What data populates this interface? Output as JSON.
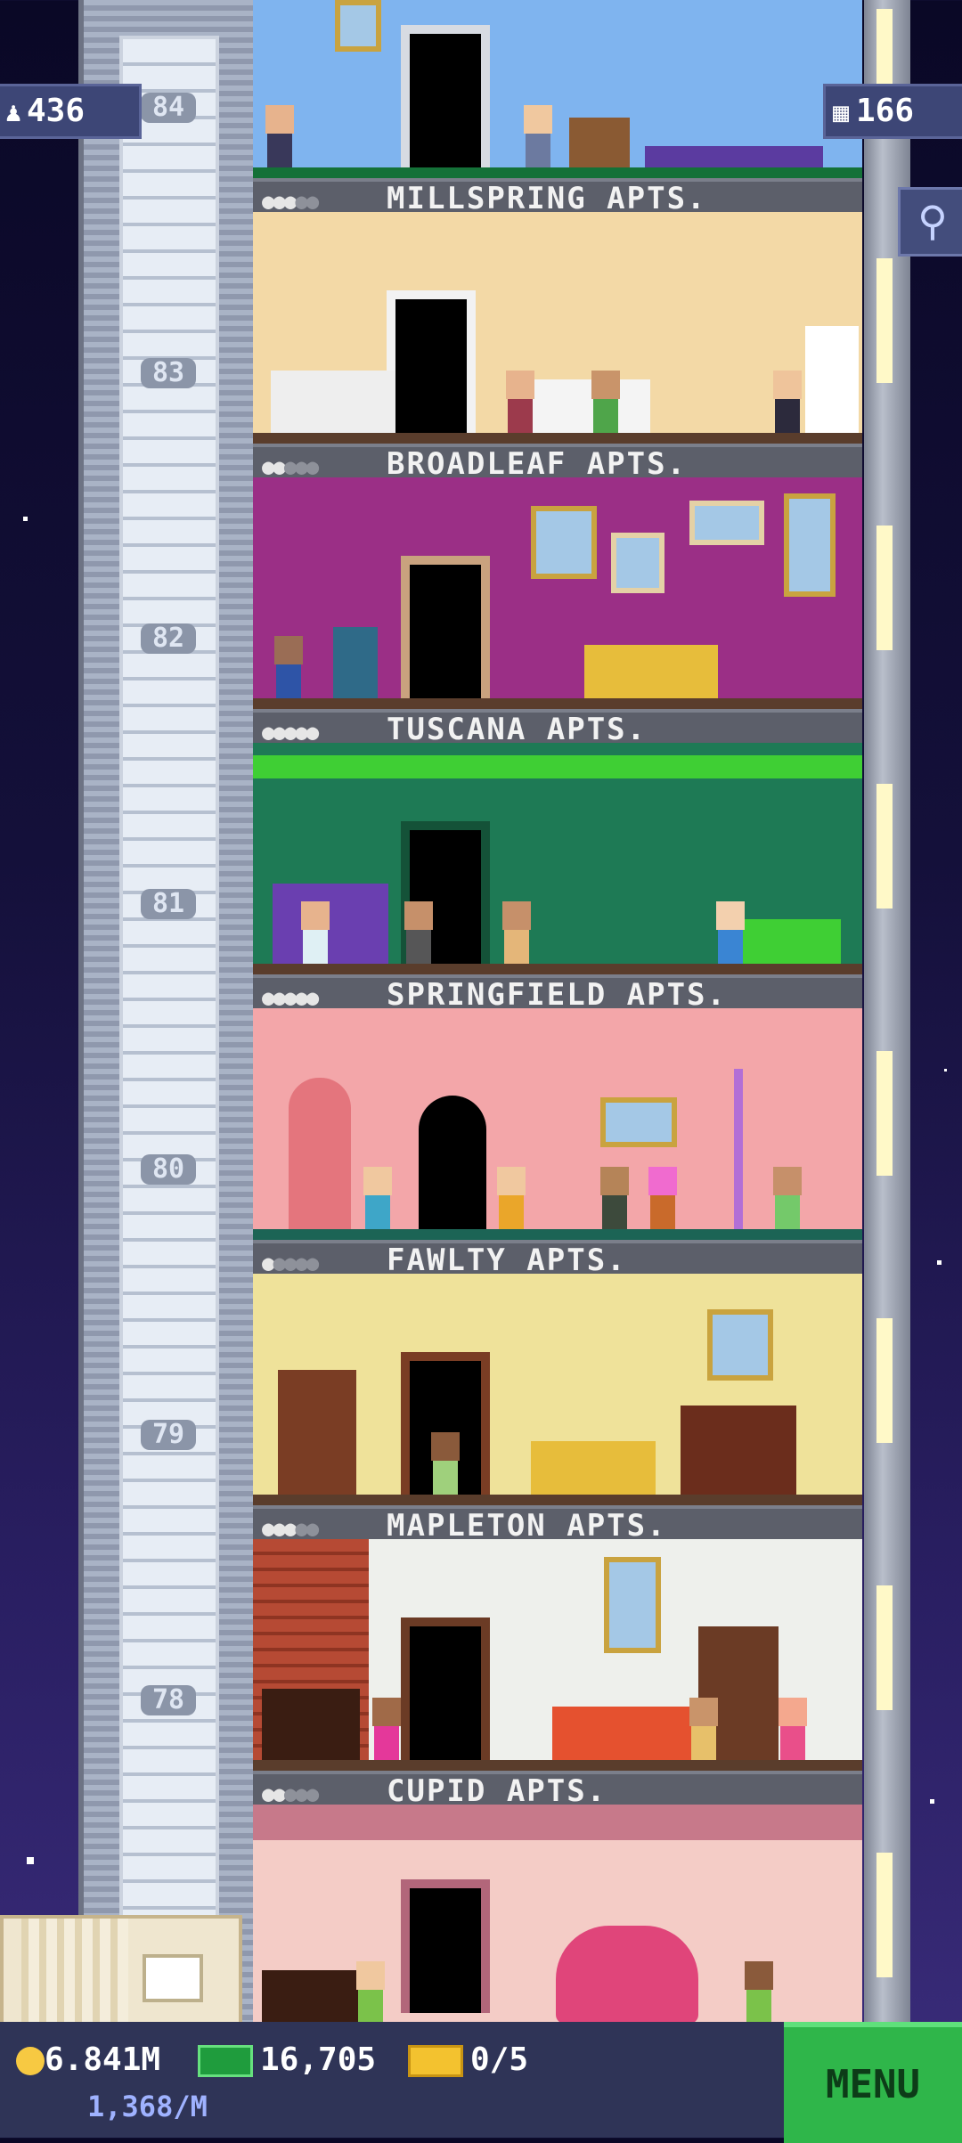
{
  "hud": {
    "population": "436",
    "floor_count": "166",
    "coins": "6.841M",
    "coin_rate": "1,368/M",
    "bux": "16,705",
    "tickets": "0/5",
    "menu_label": "MENU"
  },
  "icons": {
    "population": "person-icon",
    "floors": "building-icon",
    "search": "magnifier-icon",
    "coin": "coin-icon",
    "bux": "cash-icon",
    "ticket": "vip-ticket-icon",
    "crate": "delivery-box-icon"
  },
  "floors": [
    {
      "number": "84",
      "name": "MILLSPRING APTS.",
      "occupied": 3,
      "capacity": 5,
      "wall": "#7fb4ef"
    },
    {
      "number": "83",
      "name": "BROADLEAF APTS.",
      "occupied": 2,
      "capacity": 5,
      "wall": "#f3d9a6"
    },
    {
      "number": "82",
      "name": "TUSCANA APTS.",
      "occupied": 5,
      "capacity": 5,
      "wall": "#9b2f86"
    },
    {
      "number": "81",
      "name": "SPRINGFIELD APTS.",
      "occupied": 5,
      "capacity": 5,
      "wall": "#1e7a55"
    },
    {
      "number": "80",
      "name": "FAWLTY APTS.",
      "occupied": 1,
      "capacity": 5,
      "wall": "#f3a6a9"
    },
    {
      "number": "79",
      "name": "MAPLETON APTS.",
      "occupied": 3,
      "capacity": 5,
      "wall": "#efe29a"
    },
    {
      "number": "78",
      "name": "CUPID APTS.",
      "occupied": 2,
      "capacity": 5,
      "wall": "#eef0ec"
    },
    {
      "number": "",
      "name": "",
      "occupied": 0,
      "capacity": 0,
      "wall": "#f4ccc6"
    }
  ]
}
